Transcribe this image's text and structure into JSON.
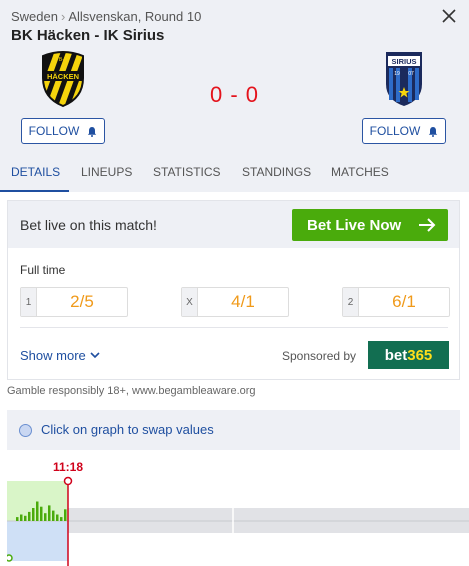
{
  "breadcrumb": {
    "country": "Sweden",
    "separator": "›",
    "competition": "Allsvenskan, Round 10"
  },
  "match": {
    "title": "BK Häcken - IK Sirius",
    "score": "0 - 0"
  },
  "home": {
    "logo_text_top": "B·K",
    "logo_text": "HÄCKEN",
    "follow_label": "FOLLOW"
  },
  "away": {
    "logo_text": "SIRIUS",
    "logo_years": [
      "19",
      "07"
    ],
    "follow_label": "FOLLOW"
  },
  "tabs": [
    {
      "label": "DETAILS",
      "active": true
    },
    {
      "label": "LINEUPS",
      "active": false
    },
    {
      "label": "STATISTICS",
      "active": false
    },
    {
      "label": "STANDINGS",
      "active": false
    },
    {
      "label": "MATCHES",
      "active": false
    }
  ],
  "betting": {
    "headline": "Bet live on this match!",
    "button_label": "Bet Live Now",
    "market": "Full time",
    "odds": [
      {
        "key": "1",
        "value": "2/5"
      },
      {
        "key": "X",
        "value": "4/1"
      },
      {
        "key": "2",
        "value": "6/1"
      }
    ],
    "show_more": "Show more",
    "sponsored_by": "Sponsored by",
    "sponsor_logo": {
      "part1": "bet",
      "part2": "365"
    }
  },
  "gamble_notice": "Gamble responsibly 18+, www.begambleaware.org",
  "swap_hint": "Click on graph to swap values",
  "graph": {
    "current_time": "11:18",
    "pressure_bar_levels": [
      0.15,
      0.25,
      0.2,
      0.35,
      0.5,
      0.75,
      0.55,
      0.3,
      0.6,
      0.4,
      0.25,
      0.15,
      0.45
    ]
  },
  "colors": {
    "accent": "#1f4fa0",
    "score": "#e4131c",
    "odds": "#f09a1a",
    "bet_button": "#4aab0c",
    "sponsor": "#126e51"
  }
}
